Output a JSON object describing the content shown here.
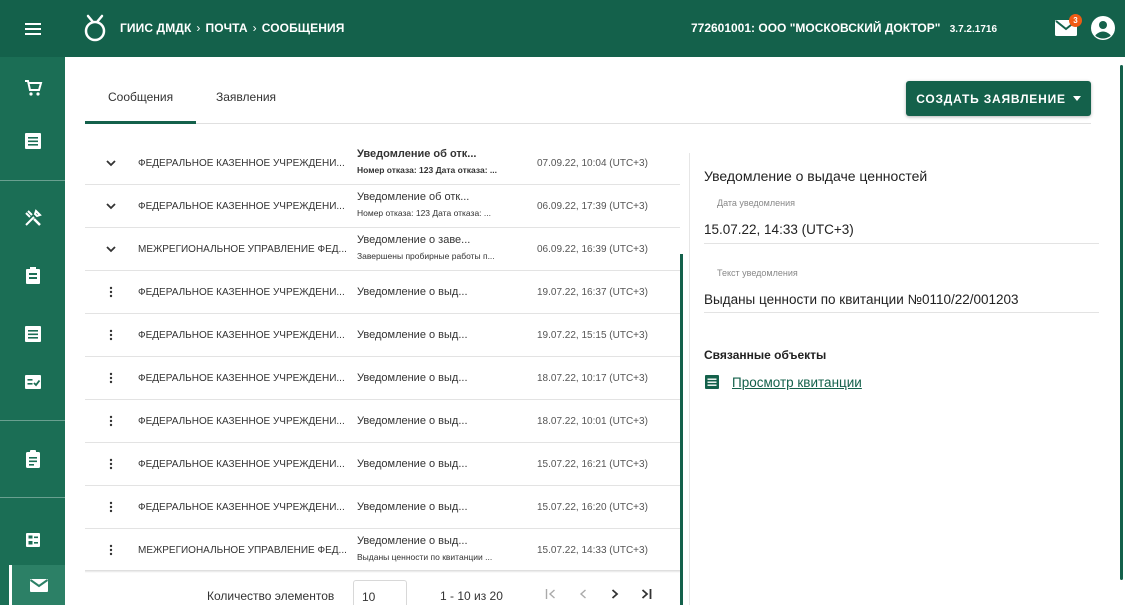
{
  "header": {
    "breadcrumbs": [
      "ГИИС ДМДК",
      "ПОЧТА",
      "СООБЩЕНИЯ"
    ],
    "organization": "772601001: ООО \"МОСКОВСКИЙ ДОКТОР\"",
    "version": "3.7.2.1716",
    "mail_badge": "3"
  },
  "tabs": [
    {
      "label": "Сообщения",
      "active": true
    },
    {
      "label": "Заявления",
      "active": false
    }
  ],
  "create_button": "СОЗДАТЬ ЗАЯВЛЕНИЕ",
  "messages": [
    {
      "control": "chevron-down",
      "sender": "ФЕДЕРАЛЬНОЕ КАЗЕННОЕ УЧРЕЖДЕНИ...",
      "title": "Уведомление об отк...",
      "subtitle": "Номер отказа: 123 Дата отказа: ...",
      "date": "07.09.22, 10:04 (UTC+3)",
      "unread": true
    },
    {
      "control": "chevron-down",
      "sender": "ФЕДЕРАЛЬНОЕ КАЗЕННОЕ УЧРЕЖДЕНИ...",
      "title": "Уведомление об отк...",
      "subtitle": "Номер отказа: 123 Дата отказа: ...",
      "date": "06.09.22, 17:39 (UTC+3)",
      "unread": false
    },
    {
      "control": "chevron-down",
      "sender": "МЕЖРЕГИОНАЛЬНОЕ УПРАВЛЕНИЕ ФЕД...",
      "title": "Уведомление о заве...",
      "subtitle": "Завершены пробирные работы п...",
      "date": "06.09.22, 16:39 (UTC+3)",
      "unread": false
    },
    {
      "control": "more-vert",
      "sender": "ФЕДЕРАЛЬНОЕ КАЗЕННОЕ УЧРЕЖДЕНИ...",
      "title": "Уведомление о выд...",
      "subtitle": "",
      "date": "19.07.22, 16:37 (UTC+3)",
      "unread": false
    },
    {
      "control": "more-vert",
      "sender": "ФЕДЕРАЛЬНОЕ КАЗЕННОЕ УЧРЕЖДЕНИ...",
      "title": "Уведомление о выд...",
      "subtitle": "",
      "date": "19.07.22, 15:15 (UTC+3)",
      "unread": false
    },
    {
      "control": "more-vert",
      "sender": "ФЕДЕРАЛЬНОЕ КАЗЕННОЕ УЧРЕЖДЕНИ...",
      "title": "Уведомление о выд...",
      "subtitle": "",
      "date": "18.07.22, 10:17 (UTC+3)",
      "unread": false
    },
    {
      "control": "more-vert",
      "sender": "ФЕДЕРАЛЬНОЕ КАЗЕННОЕ УЧРЕЖДЕНИ...",
      "title": "Уведомление о выд...",
      "subtitle": "",
      "date": "18.07.22, 10:01 (UTC+3)",
      "unread": false
    },
    {
      "control": "more-vert",
      "sender": "ФЕДЕРАЛЬНОЕ КАЗЕННОЕ УЧРЕЖДЕНИ...",
      "title": "Уведомление о выд...",
      "subtitle": "",
      "date": "15.07.22, 16:21 (UTC+3)",
      "unread": false
    },
    {
      "control": "more-vert",
      "sender": "ФЕДЕРАЛЬНОЕ КАЗЕННОЕ УЧРЕЖДЕНИ...",
      "title": "Уведомление о выд...",
      "subtitle": "",
      "date": "15.07.22, 16:20 (UTC+3)",
      "unread": false
    },
    {
      "control": "more-vert",
      "sender": "МЕЖРЕГИОНАЛЬНОЕ УПРАВЛЕНИЕ ФЕД...",
      "title": "Уведомление о выд...",
      "subtitle": "Выданы ценности по квитанции ...",
      "date": "15.07.22, 14:33 (UTC+3)",
      "unread": false
    }
  ],
  "pagination": {
    "label": "Количество элементов",
    "page_size": "10",
    "range": "1 - 10 из 20"
  },
  "detail": {
    "heading": "Уведомление о выдаче ценностей",
    "date_label": "Дата уведомления",
    "date_value": "15.07.22, 14:33 (UTC+3)",
    "text_label": "Текст уведомления",
    "text_value": "Выданы ценности по квитанции №0110/22/001203",
    "related_title": "Связанные объекты",
    "related_link": "Просмотр квитанции"
  },
  "colors": {
    "brand": "#14614b",
    "rail": "#1b6e55",
    "badge": "#ef5b14"
  },
  "icons": {
    "rail": [
      "cart-icon",
      "list-icon",
      "tools-icon",
      "badge-icon",
      "document-icon",
      "checklist-icon",
      "clipboard-icon",
      "dashboard-icon",
      "mail-icon"
    ]
  }
}
